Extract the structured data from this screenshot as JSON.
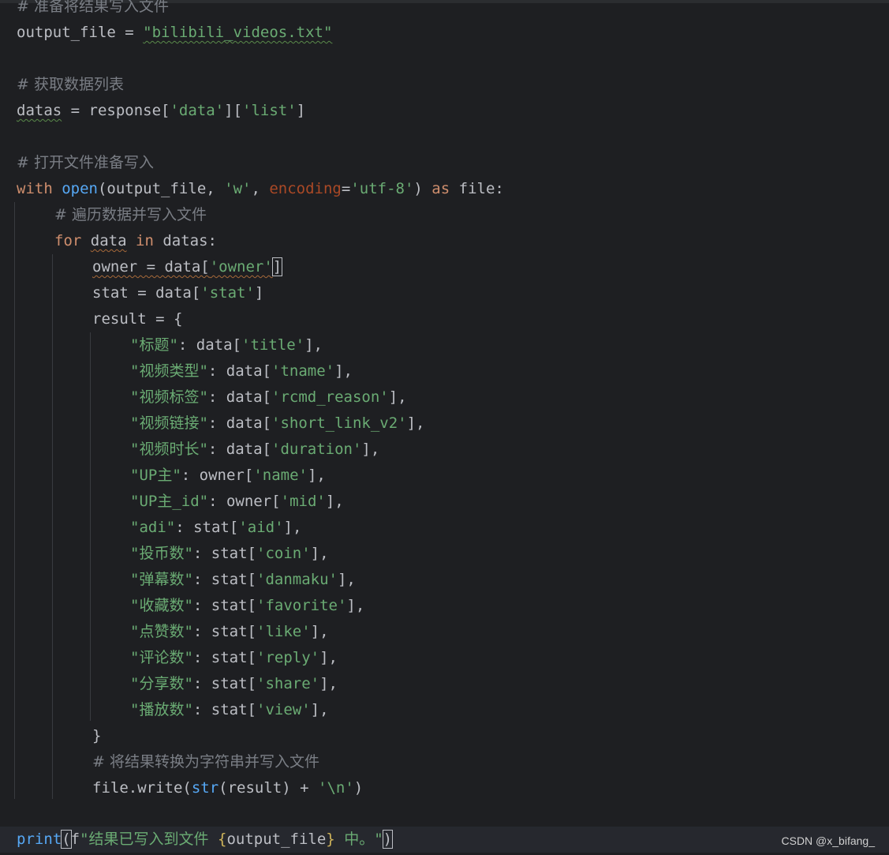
{
  "lines": {
    "l0": {
      "comment": "# 准备将结果写入文件"
    },
    "l1": {
      "var": "output_file",
      "op": " = ",
      "str": "\"bilibili_videos.txt\""
    },
    "l3": {
      "comment": "# 获取数据列表"
    },
    "l4": {
      "var": "datas",
      "rest": " = response[",
      "s1": "'data'",
      "mid": "][",
      "s2": "'list'",
      "end": "]"
    },
    "l6": {
      "comment": "# 打开文件准备写入"
    },
    "l7": {
      "kw1": "with",
      "fn": "open",
      "a": "(output_file, ",
      "s1": "'w'",
      "b": ", ",
      "param": "encoding",
      "c": "=",
      "s2": "'utf-8'",
      "d": ") ",
      "kw2": "as",
      "e": " file:"
    },
    "l8": {
      "comment": "# 遍历数据并写入文件"
    },
    "l9": {
      "kw1": "for",
      "v": "data",
      "kw2": "in",
      "rest": " datas:"
    },
    "l10": {
      "var": "owner = data[",
      "s": "'owner'",
      "end": "]"
    },
    "l11": {
      "a": "stat = data[",
      "s": "'stat'",
      "end": "]"
    },
    "l12": {
      "a": "result = {"
    },
    "dict": [
      {
        "key": "\"标题\"",
        "src": "data",
        "k": "'title'"
      },
      {
        "key": "\"视频类型\"",
        "src": "data",
        "k": "'tname'"
      },
      {
        "key": "\"视频标签\"",
        "src": "data",
        "k": "'rcmd_reason'"
      },
      {
        "key": "\"视频链接\"",
        "src": "data",
        "k": "'short_link_v2'"
      },
      {
        "key": "\"视频时长\"",
        "src": "data",
        "k": "'duration'"
      },
      {
        "key": "\"UP主\"",
        "src": "owner",
        "k": "'name'"
      },
      {
        "key": "\"UP主_id\"",
        "src": "owner",
        "k": "'mid'"
      },
      {
        "key": "\"adi\"",
        "src": "stat",
        "k": "'aid'"
      },
      {
        "key": "\"投币数\"",
        "src": "stat",
        "k": "'coin'"
      },
      {
        "key": "\"弹幕数\"",
        "src": "stat",
        "k": "'danmaku'"
      },
      {
        "key": "\"收藏数\"",
        "src": "stat",
        "k": "'favorite'"
      },
      {
        "key": "\"点赞数\"",
        "src": "stat",
        "k": "'like'"
      },
      {
        "key": "\"评论数\"",
        "src": "stat",
        "k": "'reply'"
      },
      {
        "key": "\"分享数\"",
        "src": "stat",
        "k": "'share'"
      },
      {
        "key": "\"播放数\"",
        "src": "stat",
        "k": "'view'"
      }
    ],
    "l28": {
      "a": "}"
    },
    "l29": {
      "comment": "# 将结果转换为字符串并写入文件"
    },
    "l30": {
      "a": "file.write(",
      "fn": "str",
      "b": "(result) + ",
      "s": "'\\n'",
      "end": ")"
    },
    "l32": {
      "fn": "print",
      "open": "(",
      "f": "f",
      "s1": "\"结果已写入到文件 ",
      "lb": "{",
      "v": "output_file",
      "rb": "}",
      "s2": " 中。\"",
      "close": ")"
    }
  },
  "watermark": "CSDN @x_bifang_"
}
